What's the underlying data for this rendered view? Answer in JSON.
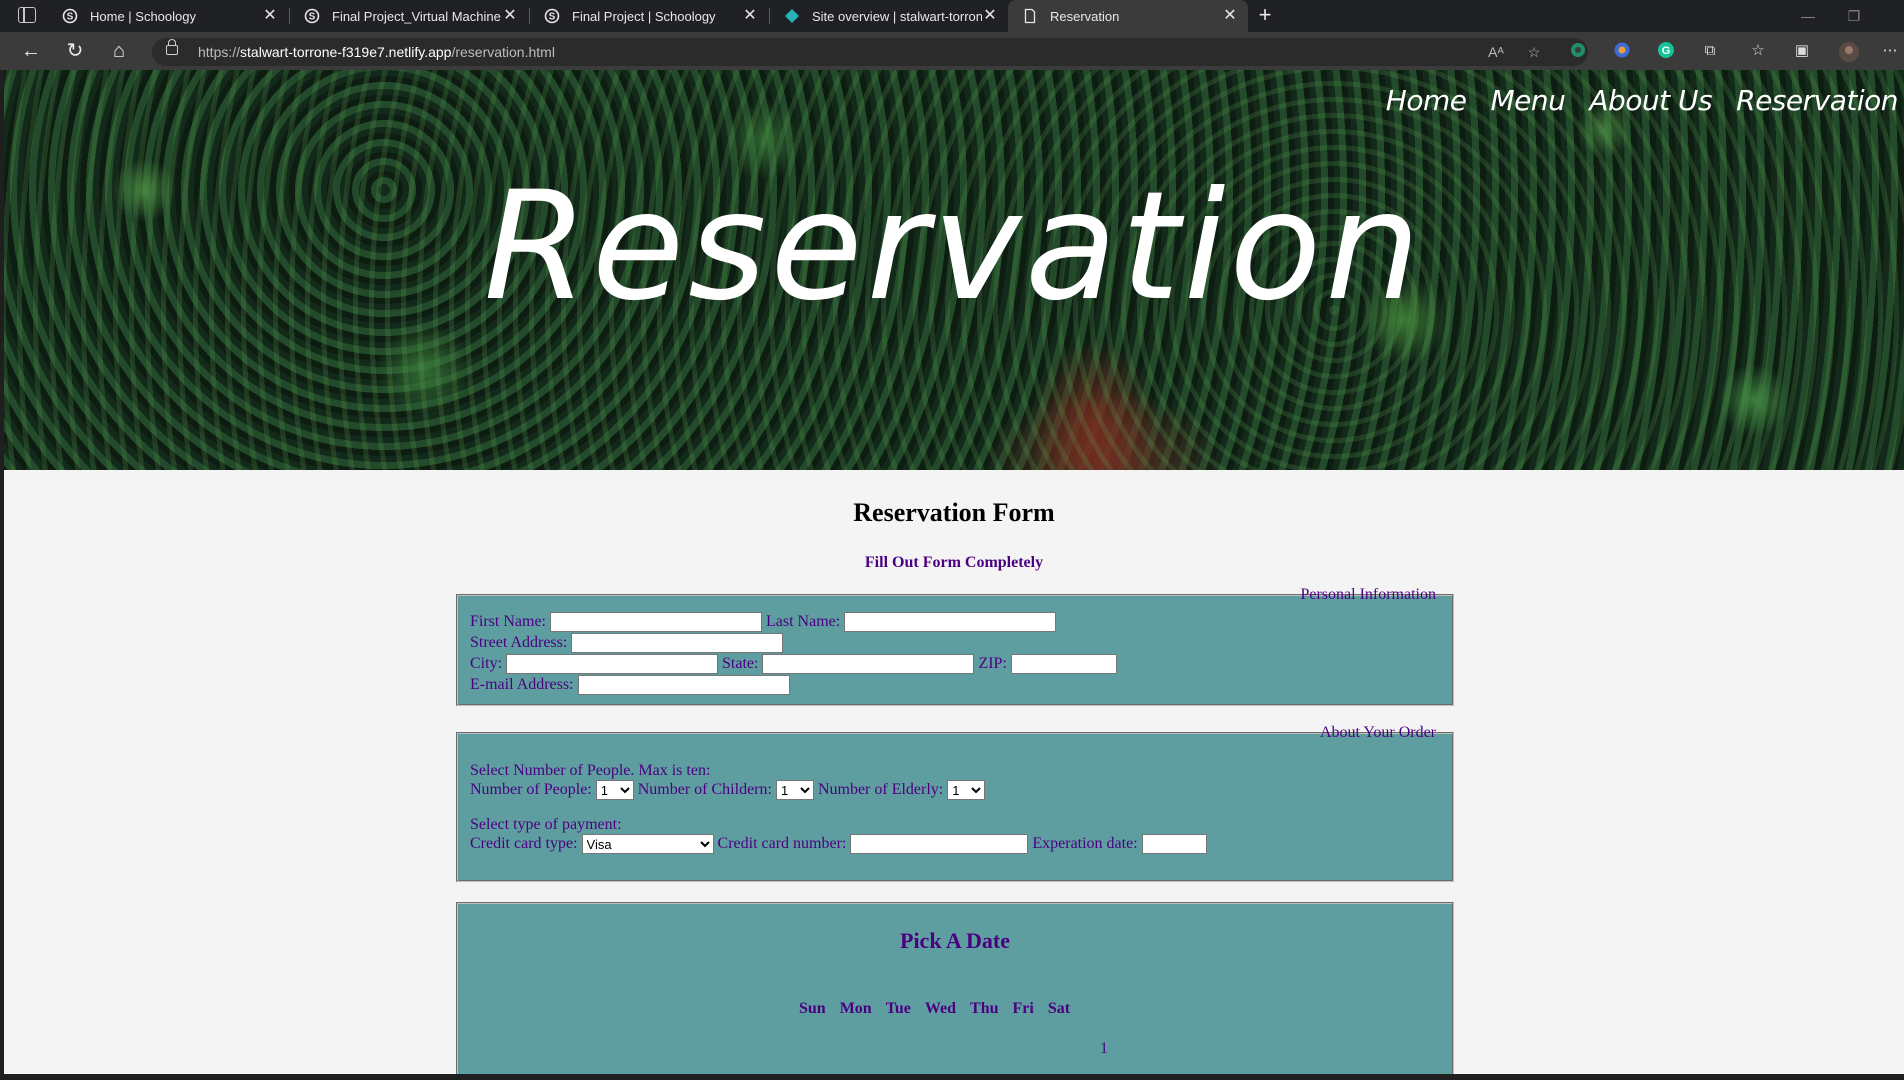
{
  "browser": {
    "tabs": [
      {
        "title": "Home | Schoology",
        "icon": "schoology-icon"
      },
      {
        "title": "Final Project_Virtual Machine | Sc",
        "icon": "schoology-icon"
      },
      {
        "title": "Final Project | Schoology",
        "icon": "schoology-icon"
      },
      {
        "title": "Site overview | stalwart-torrone-f",
        "icon": "netlify-icon"
      },
      {
        "title": "Reservation",
        "icon": "page-icon",
        "active": true
      }
    ],
    "url_scheme": "https://",
    "url_host": "stalwart-torrone-f319e7.netlify.app",
    "url_path": "/reservation.html"
  },
  "site": {
    "nav": [
      "Home",
      "Menu",
      "About Us",
      "Reservation"
    ],
    "hero_title": "Reservation"
  },
  "form": {
    "title": "Reservation Form",
    "subtitle": "Fill Out Form Completely",
    "personal": {
      "legend": "Personal Information",
      "first_name": "First Name:",
      "last_name": "Last Name:",
      "street": "Street Address:",
      "city": "City:",
      "state": "State:",
      "zip": "ZIP:",
      "email": "E-mail Address:"
    },
    "order": {
      "legend": "About Your Order",
      "people_prompt": "Select Number of People. Max is ten:",
      "people_label": "Number of People:",
      "people_value": "1",
      "children_label": "Number of Childern:",
      "children_value": "1",
      "elderly_label": "Number of Elderly:",
      "elderly_value": "1",
      "payment_prompt": "Select type of payment:",
      "card_type_label": "Credit card type:",
      "card_type_value": "Visa",
      "card_number_label": "Credit card number:",
      "expiration_label": "Experation date:"
    },
    "date": {
      "title": "Pick A Date",
      "weekdays": [
        "Sun",
        "Mon",
        "Tue",
        "Wed",
        "Thu",
        "Fri",
        "Sat"
      ],
      "first_day": "1"
    }
  },
  "colors": {
    "fieldset_bg": "#5f9ea0",
    "form_text": "#4b0082"
  }
}
